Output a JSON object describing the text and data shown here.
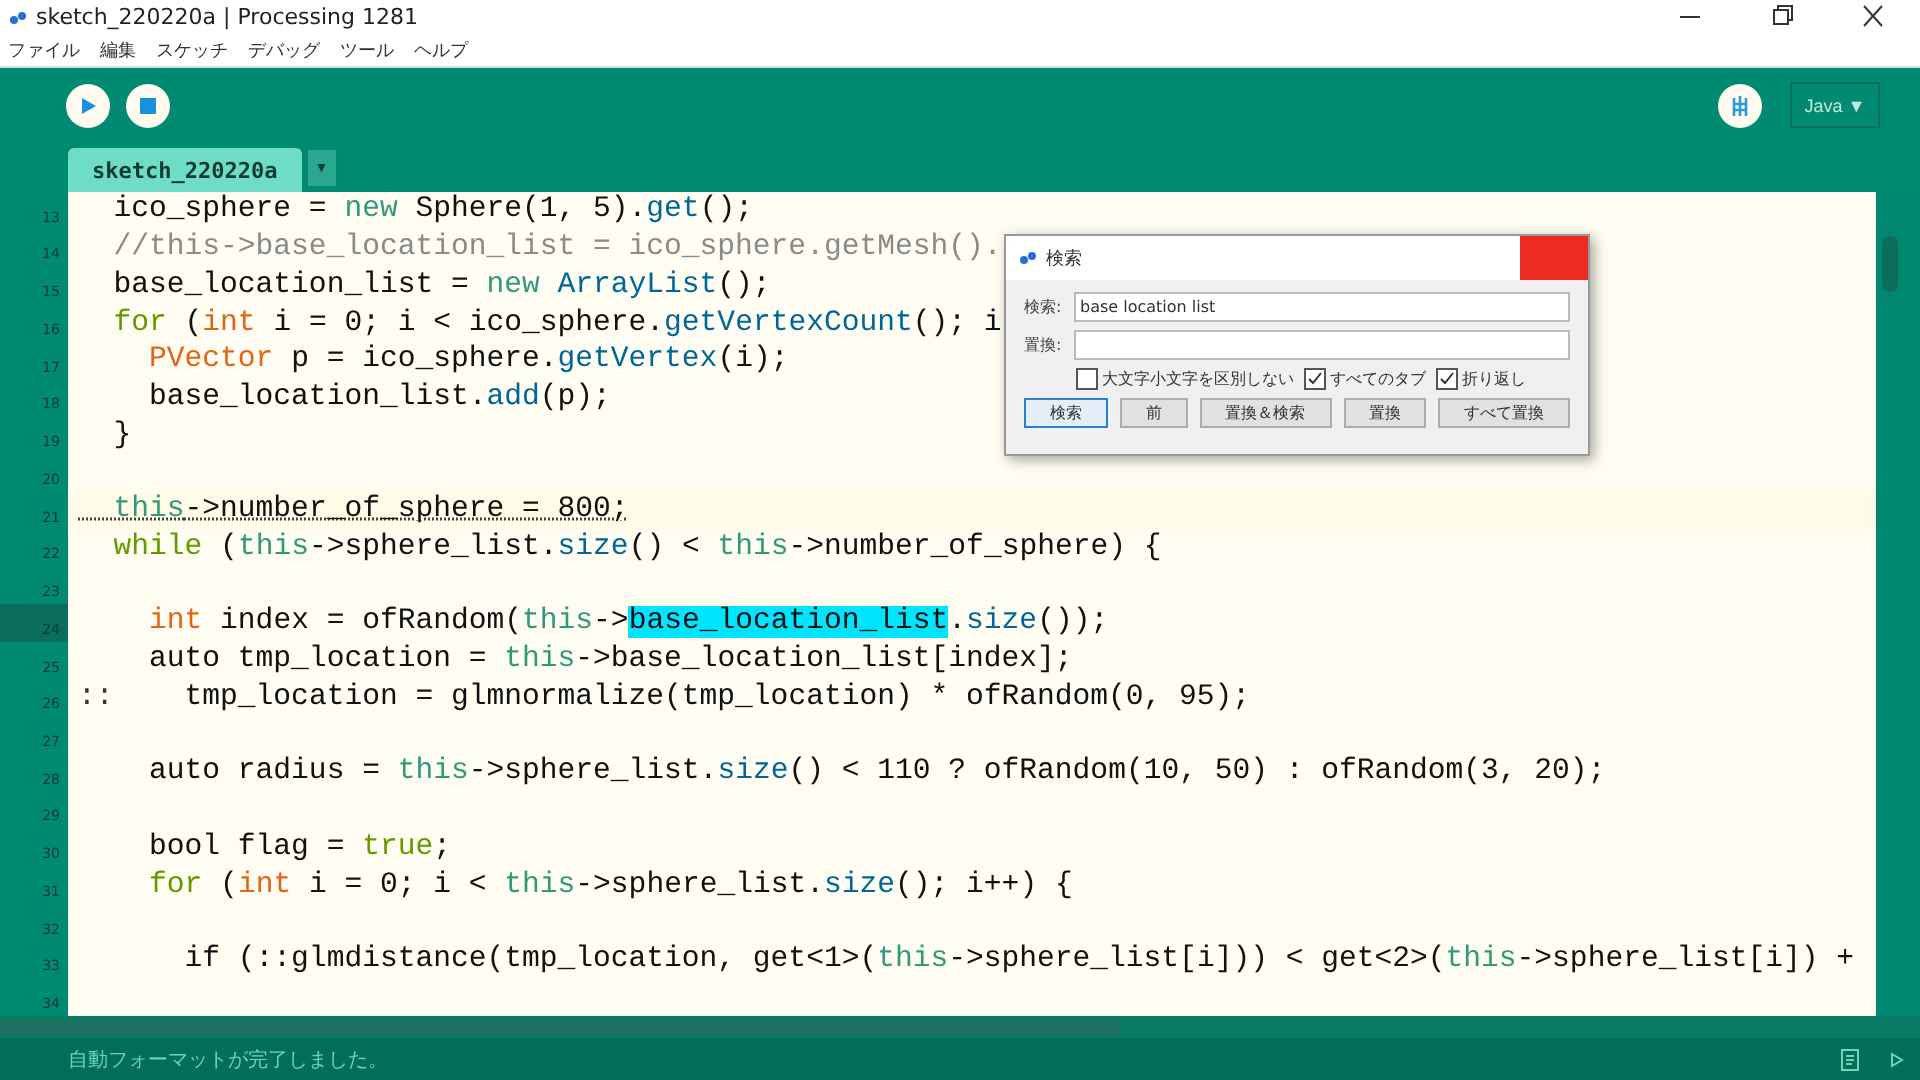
{
  "window": {
    "title": "sketch_220220a | Processing 1281"
  },
  "menu": [
    "ファイル",
    "編集",
    "スケッチ",
    "デバッグ",
    "ツール",
    "ヘルプ"
  ],
  "toolbar": {
    "mode": "Java ▼"
  },
  "tabs": [
    {
      "label": "sketch_220220a",
      "selected": true
    }
  ],
  "tab_menu": "▼",
  "editor": {
    "lines": [
      {
        "number": "13",
        "current": false,
        "warning": false,
        "segments": [
          {
            "text": "  ico_sphere = ",
            "kind": "plain"
          },
          {
            "text": "new",
            "kind": "keyword"
          },
          {
            "text": " Sphere(1, 5).",
            "kind": "plain"
          },
          {
            "text": "get",
            "kind": "method"
          },
          {
            "text": "();",
            "kind": "plain"
          }
        ]
      },
      {
        "number": "14",
        "current": false,
        "warning": false,
        "segments": [
          {
            "text": "  //this->base_location_list = ico_sphere.getMesh().",
            "kind": "comment"
          }
        ]
      },
      {
        "number": "15",
        "current": false,
        "warning": false,
        "segments": [
          {
            "text": "  base_location_list = ",
            "kind": "plain"
          },
          {
            "text": "new",
            "kind": "keyword"
          },
          {
            "text": " ArrayList",
            "kind": "method"
          },
          {
            "text": "();",
            "kind": "plain"
          }
        ]
      },
      {
        "number": "16",
        "current": false,
        "warning": false,
        "segments": [
          {
            "text": "  for",
            "kind": "control"
          },
          {
            "text": " (",
            "kind": "plain"
          },
          {
            "text": "int",
            "kind": "type"
          },
          {
            "text": " i = 0; i < ico_sphere.",
            "kind": "plain"
          },
          {
            "text": "getVertexCount",
            "kind": "method"
          },
          {
            "text": "(); i",
            "kind": "plain"
          }
        ]
      },
      {
        "number": "17",
        "current": false,
        "warning": false,
        "segments": [
          {
            "text": "    PVector",
            "kind": "type"
          },
          {
            "text": " p = ico_sphere.",
            "kind": "plain"
          },
          {
            "text": "getVertex",
            "kind": "method"
          },
          {
            "text": "(i);",
            "kind": "plain"
          }
        ]
      },
      {
        "number": "18",
        "current": false,
        "warning": false,
        "segments": [
          {
            "text": "    base_location_list.",
            "kind": "plain"
          },
          {
            "text": "add",
            "kind": "method"
          },
          {
            "text": "(p);",
            "kind": "plain"
          }
        ]
      },
      {
        "number": "19",
        "current": false,
        "warning": false,
        "segments": [
          {
            "text": "  }",
            "kind": "plain"
          }
        ]
      },
      {
        "number": "20",
        "current": false,
        "warning": false
      },
      {
        "number": "21",
        "current": false,
        "warning": true,
        "segments": [
          {
            "text": "  this",
            "kind": "keyword"
          },
          {
            "text": "->number_of_sphere = 800;",
            "kind": "plain"
          }
        ]
      },
      {
        "number": "22",
        "current": false,
        "warning": false,
        "segments": [
          {
            "text": "  while",
            "kind": "control"
          },
          {
            "text": " (",
            "kind": "plain"
          },
          {
            "text": "this",
            "kind": "keyword"
          },
          {
            "text": "->sphere_list.",
            "kind": "plain"
          },
          {
            "text": "size",
            "kind": "method"
          },
          {
            "text": "() < ",
            "kind": "plain"
          },
          {
            "text": "this",
            "kind": "keyword"
          },
          {
            "text": "->number_of_sphere) {",
            "kind": "plain"
          }
        ]
      },
      {
        "number": "23",
        "current": false,
        "warning": false
      },
      {
        "number": "24",
        "current": true,
        "warning": false,
        "segments": [
          {
            "text": "    int",
            "kind": "type"
          },
          {
            "text": " index = ofRandom(",
            "kind": "plain"
          },
          {
            "text": "this",
            "kind": "keyword"
          },
          {
            "text": "->",
            "kind": "plain"
          },
          {
            "text": "base_location_list",
            "kind": "match"
          },
          {
            "text": ".",
            "kind": "plain"
          },
          {
            "text": "size",
            "kind": "method"
          },
          {
            "text": "());",
            "kind": "plain"
          }
        ]
      },
      {
        "number": "25",
        "current": false,
        "warning": false,
        "segments": [
          {
            "text": "    auto tmp_location = ",
            "kind": "plain"
          },
          {
            "text": "this",
            "kind": "keyword"
          },
          {
            "text": "->base_location_list[index];",
            "kind": "plain"
          }
        ]
      },
      {
        "number": "26",
        "current": false,
        "warning": false,
        "marker": "::",
        "segments": [
          {
            "text": "    tmp_location = glmnormalize(tmp_location) * ofRandom(0, 95);",
            "kind": "plain"
          }
        ]
      },
      {
        "number": "27",
        "current": false,
        "warning": false
      },
      {
        "number": "28",
        "current": false,
        "warning": false,
        "segments": [
          {
            "text": "    auto radius = ",
            "kind": "plain"
          },
          {
            "text": "this",
            "kind": "keyword"
          },
          {
            "text": "->sphere_list.",
            "kind": "plain"
          },
          {
            "text": "size",
            "kind": "method"
          },
          {
            "text": "() < 110 ? ofRandom(10, 50) : ofRandom(3, 20);",
            "kind": "plain"
          }
        ]
      },
      {
        "number": "29",
        "current": false,
        "warning": false
      },
      {
        "number": "30",
        "current": false,
        "warning": false,
        "segments": [
          {
            "text": "    bool flag = ",
            "kind": "plain"
          },
          {
            "text": "true",
            "kind": "control"
          },
          {
            "text": ";",
            "kind": "plain"
          }
        ]
      },
      {
        "number": "31",
        "current": false,
        "warning": false,
        "segments": [
          {
            "text": "    for",
            "kind": "control"
          },
          {
            "text": " (",
            "kind": "plain"
          },
          {
            "text": "int",
            "kind": "type"
          },
          {
            "text": " i = 0; i < ",
            "kind": "plain"
          },
          {
            "text": "this",
            "kind": "keyword"
          },
          {
            "text": "->sphere_list.",
            "kind": "plain"
          },
          {
            "text": "size",
            "kind": "method"
          },
          {
            "text": "(); i++) {",
            "kind": "plain"
          }
        ]
      },
      {
        "number": "32",
        "current": false,
        "warning": false
      },
      {
        "number": "33",
        "current": false,
        "warning": false,
        "segments": [
          {
            "text": "      if (::glmdistance(tmp_location, get<1>(",
            "kind": "plain"
          },
          {
            "text": "this",
            "kind": "keyword"
          },
          {
            "text": "->sphere_list[i])) < get<2>(",
            "kind": "plain"
          },
          {
            "text": "this",
            "kind": "keyword"
          },
          {
            "text": "->sphere_list[i]) +",
            "kind": "plain"
          }
        ]
      },
      {
        "number": "34",
        "current": false,
        "warning": false
      }
    ]
  },
  "find_dialog": {
    "title": "検索",
    "fields": [
      {
        "label": "検索:",
        "value": "base location list"
      },
      {
        "label": "置換:"
      }
    ],
    "options": [
      {
        "label": "大文字小文字を区別しない",
        "checked": false
      },
      {
        "label": "すべてのタブ",
        "checked": true
      },
      {
        "label": "折り返し",
        "checked": true
      }
    ],
    "buttons": [
      {
        "label": "検索",
        "selected": true
      },
      {
        "label": "前",
        "selected": false
      },
      {
        "label": "置換＆検索",
        "selected": false
      },
      {
        "label": "置換",
        "selected": false
      },
      {
        "label": "すべて置換",
        "selected": false
      }
    ]
  },
  "status_bar": {
    "message": "自動フォーマットが完了しました。"
  }
}
